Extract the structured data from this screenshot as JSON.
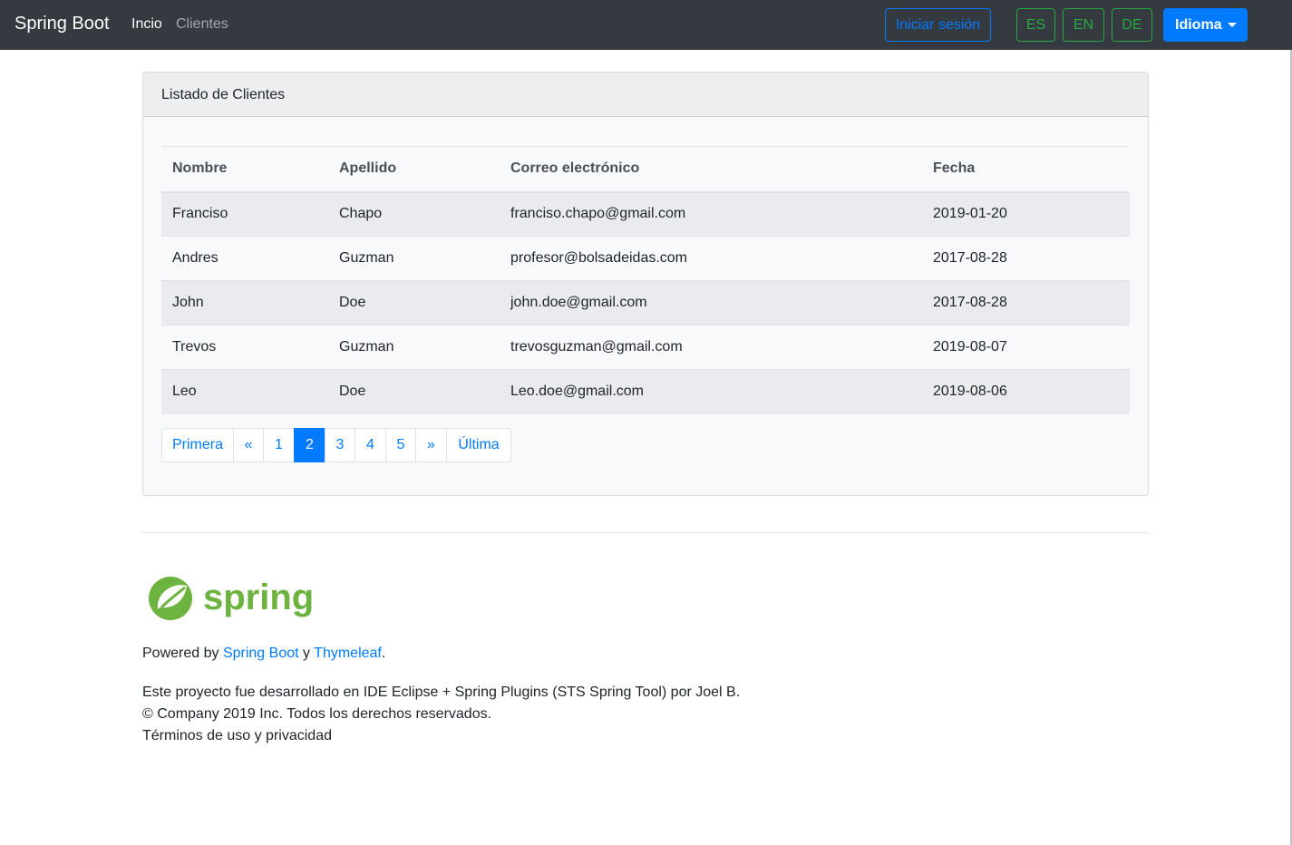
{
  "navbar": {
    "brand": "Spring Boot",
    "links": [
      {
        "label": "Incio",
        "active": true
      },
      {
        "label": "Clientes",
        "active": false
      }
    ],
    "login_label": "Iniciar sesión",
    "languages": [
      "ES",
      "EN",
      "DE"
    ],
    "language_dropdown_label": "Idioma"
  },
  "card": {
    "header": "Listado de Clientes",
    "table": {
      "columns": [
        "Nombre",
        "Apellido",
        "Correo electrónico",
        "Fecha"
      ],
      "rows": [
        [
          "Franciso",
          "Chapo",
          "franciso.chapo@gmail.com",
          "2019-01-20"
        ],
        [
          "Andres",
          "Guzman",
          "profesor@bolsadeidas.com",
          "2017-08-28"
        ],
        [
          "John",
          "Doe",
          "john.doe@gmail.com",
          "2017-08-28"
        ],
        [
          "Trevos",
          "Guzman",
          "trevosguzman@gmail.com",
          "2019-08-07"
        ],
        [
          "Leo",
          "Doe",
          "Leo.doe@gmail.com",
          "2019-08-06"
        ]
      ]
    },
    "pagination": {
      "first_label": "Primera",
      "prev_label": "«",
      "pages": [
        "1",
        "2",
        "3",
        "4",
        "5"
      ],
      "current_page": "2",
      "next_label": "»",
      "last_label": "Última"
    }
  },
  "footer": {
    "logo_text": "spring",
    "powered_prefix": "Powered by",
    "powered_link1": "Spring Boot",
    "powered_conjunction": "y",
    "powered_link2": "Thymeleaf",
    "powered_suffix": ".",
    "line1": "Este proyecto fue desarrollado en IDE Eclipse + Spring Plugins (STS Spring Tool) por Joel B.",
    "line2": "© Company 2019 Inc. Todos los derechos reservados.",
    "line3": "Términos de uso y privacidad"
  },
  "colors": {
    "navbar_bg": "#343a40",
    "primary": "#007bff",
    "success": "#28a745",
    "spring_green": "#6db33f"
  }
}
